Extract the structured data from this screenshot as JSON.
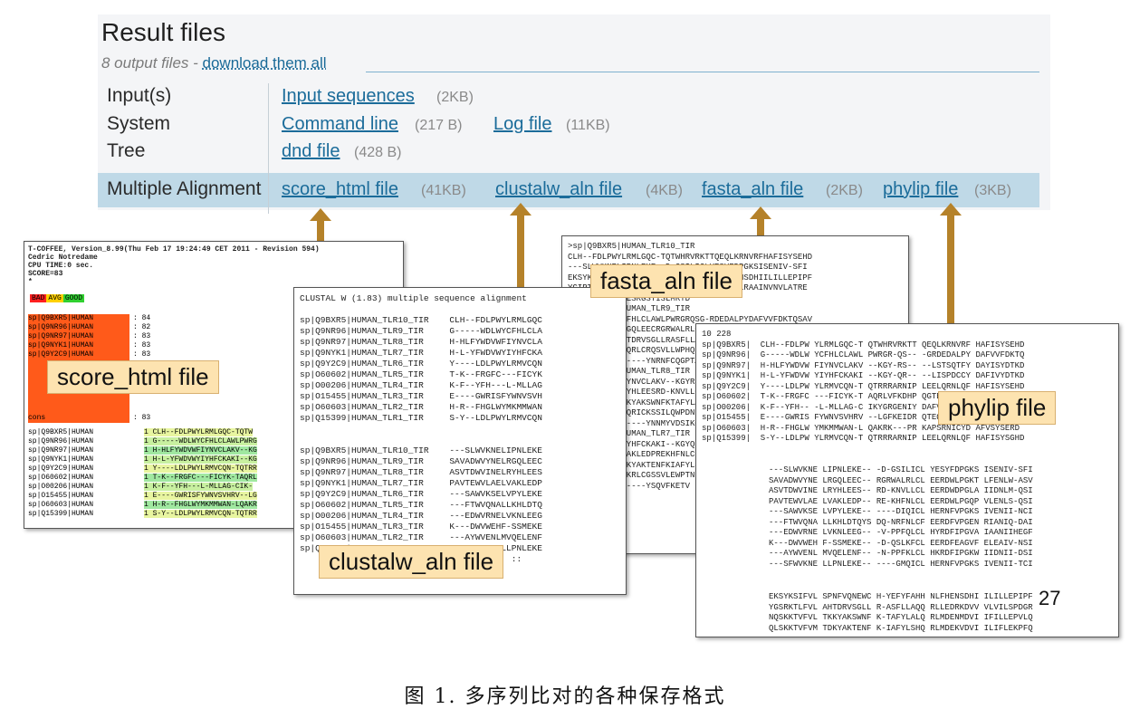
{
  "panel": {
    "title": "Result files",
    "subtitle_prefix": "8 output files - ",
    "download_label": "download them all"
  },
  "rows": [
    {
      "label": "Input(s)",
      "files": [
        {
          "name": "Input sequences",
          "size": "(2KB)"
        }
      ]
    },
    {
      "label": "System",
      "files": [
        {
          "name": "Command line",
          "size": "(217 B)"
        },
        {
          "name": "Log file",
          "size": "(11KB)"
        }
      ]
    },
    {
      "label": "Tree",
      "files": [
        {
          "name": "dnd file",
          "size": "(428 B)"
        }
      ]
    },
    {
      "label": "Multiple Alignment",
      "files": [
        {
          "name": "score_html file",
          "size": "(41KB)"
        },
        {
          "name": "clustalw_aln file",
          "size": "(4KB)"
        },
        {
          "name": "fasta_aln file",
          "size": "(2KB)"
        },
        {
          "name": "phylip file",
          "size": "(3KB)"
        }
      ]
    }
  ],
  "arrow_color": "#b5822a",
  "score_box": {
    "header": [
      "T-COFFEE, Version_8.99(Thu Feb 17 19:24:49 CET 2011 - Revision 594)",
      "Cedric Notredame",
      "CPU TIME:0 sec.",
      "SCORE=83",
      "*"
    ],
    "legend": [
      "BAD",
      "AVG",
      "GOOD"
    ],
    "scores": [
      {
        "name": "sp|Q9BXR5|HUMAN",
        "score": "84"
      },
      {
        "name": "sp|Q9NR96|HUMAN",
        "score": "82"
      },
      {
        "name": "sp|Q9NR97|HUMAN",
        "score": "83"
      },
      {
        "name": "sp|Q9NYK1|HUMAN",
        "score": "83"
      },
      {
        "name": "sp|Q9Y2C9|HUMAN",
        "score": "83"
      }
    ],
    "cons": {
      "name": "cons",
      "score": "83"
    },
    "rows": [
      {
        "name": "sp|Q9BXR5|HUMAN",
        "seq": "1 CLH--FDLPWYLRMLGQC-TQTW"
      },
      {
        "name": "sp|Q9NR96|HUMAN",
        "seq": "1 G-----WDLWYCFHLCLAWLPWRG"
      },
      {
        "name": "sp|Q9NR97|HUMAN",
        "seq": "1 H-HLFYWDVWFIYNVCLAKV--KG"
      },
      {
        "name": "sp|Q9NYK1|HUMAN",
        "seq": "1 H-L-YFWDVWYIYHFCKAKI--KG"
      },
      {
        "name": "sp|Q9Y2C9|HUMAN",
        "seq": "1 Y----LDLPWYLRMVCQN-TQTRR"
      },
      {
        "name": "sp|O60602|HUMAN",
        "seq": "1 T-K--FRGFC---FICYK-TAQRL"
      },
      {
        "name": "sp|O00206|HUMAN",
        "seq": "1 K-F--YFH---L-MLLAG-CIK-"
      },
      {
        "name": "sp|O15455|HUMAN",
        "seq": "1 E----GWRISFYWNVSVHRV--LG"
      },
      {
        "name": "sp|O60603|HUMAN",
        "seq": "1 H-R--FHGLWYMKMMWAN-LQAKR"
      },
      {
        "name": "sp|Q15399|HUMAN",
        "seq": "1 S-Y--LDLPWYLRMVCQN-TQTRR"
      }
    ],
    "caption": "score_html file"
  },
  "clustal_box": {
    "header": "CLUSTAL W (1.83) multiple sequence alignment",
    "block1": [
      "sp|Q9BXR5|HUMAN_TLR10_TIR    CLH--FDLPWYLRMLGQC",
      "sp|Q9NR96|HUMAN_TLR9_TIR     G-----WDLWYCFHLCLA",
      "sp|Q9NR97|HUMAN_TLR8_TIR     H-HLFYWDVWFIYNVCLA",
      "sp|Q9NYK1|HUMAN_TLR7_TIR     H-L-YFWDVWYIYHFCKA",
      "sp|Q9Y2C9|HUMAN_TLR6_TIR     Y----LDLPWYLRMVCQN",
      "sp|O60602|HUMAN_TLR5_TIR     T-K--FRGFC---FICYK",
      "sp|O00206|HUMAN_TLR4_TIR     K-F--YFH---L-MLLAG",
      "sp|O15455|HUMAN_TLR3_TIR     E----GWRISFYWNVSVH",
      "sp|O60603|HUMAN_TLR2_TIR     H-R--FHGLWYMKMMWAN",
      "sp|Q15399|HUMAN_TLR1_TIR     S-Y--LDLPWYLRMVCQN"
    ],
    "block2": [
      "sp|Q9BXR5|HUMAN_TLR10_TIR    ---SLWVKNELIPNLEKE",
      "sp|Q9NR96|HUMAN_TLR9_TIR     SAVADWVYNELRGQLEEC",
      "sp|Q9NR97|HUMAN_TLR8_TIR     ASVTDWVINELRYHLEES",
      "sp|Q9NYK1|HUMAN_TLR7_TIR     PAVTEWVLAELVAKLEDP",
      "sp|Q9Y2C9|HUMAN_TLR6_TIR     ---SAWVKSELVPYLEKE",
      "sp|O60602|HUMAN_TLR5_TIR     ---FTWVQNALLKHLDTQ",
      "sp|O00206|HUMAN_TLR4_TIR     ---EDWVRNELVKNLEEG",
      "sp|O15455|HUMAN_TLR3_TIR     K---DWVWEHF-SSMEKE",
      "sp|O60603|HUMAN_TLR2_TIR     ---AYWVENLMVQELENF",
      "sp|Q15399|HUMAN_TLR1_TIR     ---SFWVKNELLPNLEKE"
    ],
    "footer": "                                     ::  ::",
    "caption": "clustalw_aln file"
  },
  "fasta_box": {
    "lines": [
      ">sp|Q9BXR5|HUMAN_TLR10_TIR",
      "CLH--FDLPWYLRMLGQC-TQTWHRVRKTTQEQLKRNVRFHAFISYSEHD",
      "---SLWVKNELIPNLEKE--D-GSILICLYESYFDPGKSISENIV-SFI",
      "EKSYKSIFVLSPNFVQNEWCH-YEFYFAHHNLFHENSDHIILILLEPIPF",
      "YCIPTRYHKLEALLEKKAYLEWPKDRRKCGLFWANLRAAINVNVLATRE",
      "MYELQTFTELNEESRGSTISLMRTD",
      ">sp|Q9NR96|HUMAN_TLR9_TIR",
      "G-----WDLWYCFHLCLAWLPWRGRQSG-RDEDALPYDAFVVFDKTQSAV",
      "SAVADWVYNELRGQLEECRGRWALRLCLEERDWLPGKTLFENLWASVYGS",
      "YGSRKTLFVLAHTDRVSGLLRASFLLAQQRLLEDRKDVVVLVILSPDGRR",
      "R---SRYVRL-RQRLCRQSVLLWPHQPSGQRSFWAQLGMALTRDNHHFYN",
      "--------F-------YNRNFCQGPTAE",
      ">sp|Q9NR97|HUMAN_TLR8_TIR",
      "H-HLFYWDVWFIYNVCLAKV--KGYRSLSTSQTFYDAYISYDTKDASVTD",
      "ASVTDWVINELRYHLEESRD-KNVLLCLEERDWDPGLAIIDNLMQSINQS",
      "NQSKKTVFVLTKKYAKSWNFKTAFYLALQRLMDENMDVIIFILLEPVLQH",
      "H---SQYLRL-RQRICKSSILQWPDNPKAEGLFWQTLRNVVLTENDSRYN",
      "--------R-------YNNMYVDSIKQY",
      ">sp|Q9NYK1|HUMAN_TLR7_TIR",
      "H-L-YFWDVWYIYHFCKAKI--KGYQRLISPDCCYDAFIVYDTKDPAVTE",
      "PAVTEWVLAELVAKLEDPREKHFNLCLEERDWLPGQPVLENLSQSIQLSK",
      "QLSKKTVFVMTDKYAKTENFKIAFYLSHQRLMDEKVDVIILIFLEKPFQK",
      "K---SKFLQL-RKRLCGSSVLEWPTNPQAHPYFWQCLKNALATDNHVAYS",
      "--------A-------YSQVFKETV"
    ],
    "caption": "fasta_aln file"
  },
  "phylip_box": {
    "header": "10 228",
    "block1": [
      "sp|Q9BXR5|  CLH--FDLPW YLRMLGQC-T QTWHRVRKTT QEQLKRNVRF HAFISYSEHD",
      "sp|Q9NR96|  G-----WDLW YCFHLCLAWL PWRGR-QS-- -GRDEDALPY DAFVVFDKTQ",
      "sp|Q9NR97|  H-HLFYWDVW FIYNVCLAKV --KGY-RS-- --LSTSQTFY DAYISYDTKD",
      "sp|Q9NYK1|  H-L-YFWDVW YIYHFCKAKI --KGY-QR-- --LISPDCCY DAFIVYDTKD",
      "sp|Q9Y2C9|  Y----LDLPW YLRMVCQN-T QTRRRARNIP LEELQRNLQF HAFISYSEHD",
      "sp|O60602|  T-K--FRGFC ---FICYK-T AQRLVFKDHP QGTEPDMYKY DAYLCFSSKD",
      "sp|O00206|  K-F--YFH-- -L-MLLAG-C IKYGRGENIY DAFVIYSSQD",
      "sp|O15455|  E----GWRIS FYWNVSVHRV --LGFKEIDR QTEQFEYAAY IIHAYKD",
      "sp|O60603|  H-R--FHGLW YMKMMWAN-L QAKRK---PR KAPSRNICYD AFVSYSERD",
      "sp|Q15399|  S-Y--LDLPW YLRMVCQN-T QTRRRARNIP LEELQRNLQF HAFISYSGHD"
    ],
    "block2": [
      "---SLWVKNE LIPNLEKE-- -D-GSILICL YESYFDPGKS ISENIV-SFI",
      "SAVADWVYNE LRGQLEEC-- RGRWALRLCL EERDWLPGKT LFENLW-ASV",
      "ASVTDWVINE LRYHLEES-- RD-KNVLLCL EERDWDPGLA IIDNLM-QSI",
      "PAVTEWVLAE LVAKLEDP-- RE-KHFNLCL EERDWLPGQP VLENLS-QSI",
      "---SAWVKSE LVPYLEKE-- ----DIQICL HERNFVPGKS IVENII-NCI",
      "---FTWVQNA LLKHLDTQYS DQ-NRFNLCF EERDFVPGEN RIANIQ-DAI",
      "---EDWVRNE LVKNLEEG-- -V-PPFQLCL HYRDFIPGVA IAANIIHEGF",
      "K---DWVWEH F-SSMEKE-- -D-QSLKFCL EERDFEAGVF ELEAIV-NSI",
      "---AYWVENL MVQELENF-- -N-PPFKLCL HKRDFIPGKW IIDNII-DSI",
      "---SFWVKNE LLPNLEKE-- ----GMQICL HERNFVPGKS IVENII-TCI"
    ],
    "block3": [
      "EKSYKSIFVL SPNFVQNEWC H-YEFYFAHH NLFHENSDHI ILILLEPIPF",
      "YGSRKTLFVL AHTDRVSGLL R-ASFLLAQQ RLLEDRKDVV VLVILSPDGR",
      "NQSKKTVFVL TKKYAKSWNF K-TAFYLALQ RLMDENMDVI IFILLEPVLQ",
      "QLSKKTVFVM TDKYAKTENF K-IAFYLSHQ RLMDEKVDVI ILIFLEKPFQ"
    ],
    "page_number": "27",
    "caption": "phylip file"
  },
  "figure_caption": "图 1. 多序列比对的各种保存格式"
}
